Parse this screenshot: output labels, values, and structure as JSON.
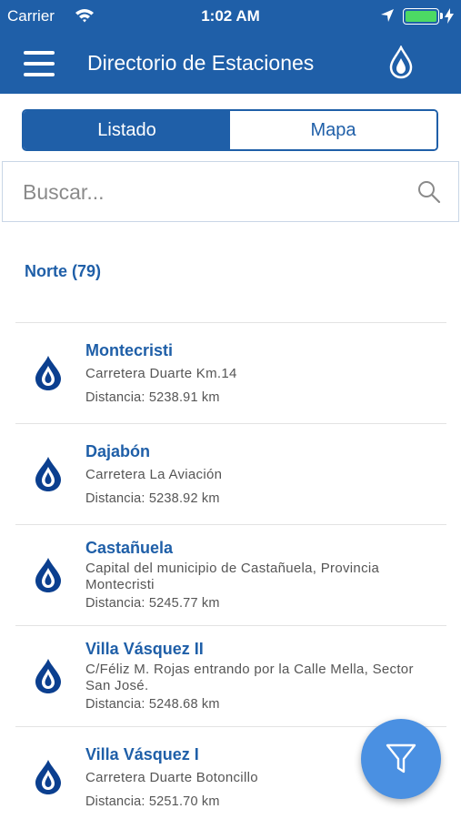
{
  "status_bar": {
    "carrier": "Carrier",
    "time": "1:02 AM",
    "icons": [
      "wifi-icon",
      "location-arrow-icon",
      "battery-icon",
      "charging-bolt-icon"
    ]
  },
  "nav_bar": {
    "title": "Directorio de Estaciones",
    "left_icon": "hamburger-menu-icon",
    "right_icon": "fuel-drop-icon"
  },
  "segment": {
    "items": [
      {
        "label": "Listado",
        "active": true
      },
      {
        "label": "Mapa",
        "active": false
      }
    ]
  },
  "search": {
    "placeholder": "Buscar...",
    "value": "",
    "icon": "search-icon"
  },
  "section": {
    "header": "Norte (79)"
  },
  "stations": [
    {
      "name": "Montecristi",
      "address": "Carretera Duarte Km.14",
      "distance": "Distancia: 5238.91 km"
    },
    {
      "name": "Dajabón",
      "address": "Carretera La Aviación",
      "distance": "Distancia: 5238.92 km"
    },
    {
      "name": "Castañuela",
      "address": "Capital del municipio de Castañuela, Provincia Montecristi",
      "distance": "Distancia: 5245.77 km"
    },
    {
      "name": "Villa Vásquez II",
      "address": "C/Féliz M. Rojas entrando por la Calle Mella, Sector San José.",
      "distance": "Distancia: 5248.68 km"
    },
    {
      "name": "Villa Vásquez I",
      "address": "Carretera Duarte Botoncillo",
      "distance": "Distancia: 5251.70 km"
    }
  ],
  "fab": {
    "icon": "filter-icon"
  },
  "colors": {
    "primary": "#1f5fa8",
    "fab": "#4a90e2",
    "battery": "#4cd964"
  }
}
